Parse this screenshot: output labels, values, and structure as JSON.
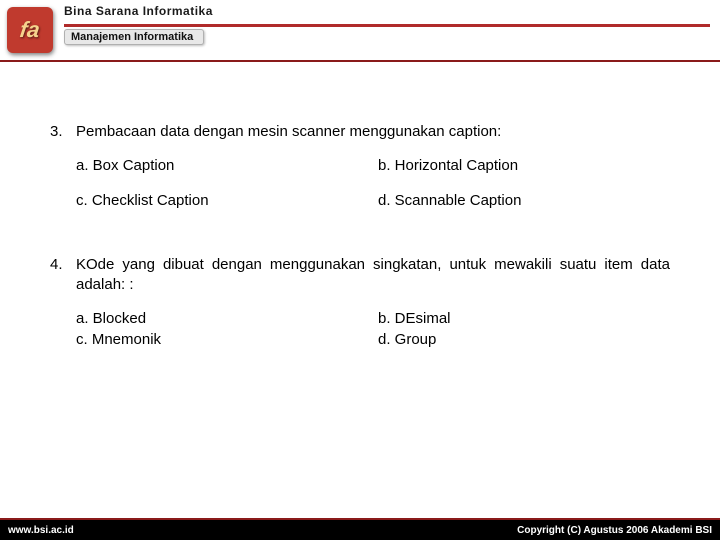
{
  "header": {
    "org_title": "Bina Sarana Informatika",
    "program": "Manajemen Informatika",
    "logo_text": "fa"
  },
  "questions": [
    {
      "num": "3.",
      "text": "Pembacaan data dengan mesin scanner menggunakan caption:",
      "opts": {
        "a": "a. Box Caption",
        "b": "b. Horizontal Caption",
        "c": "c. Checklist Caption",
        "d": "d. Scannable Caption"
      }
    },
    {
      "num": "4.",
      "text": "KOde yang dibuat dengan menggunakan singkatan, untuk mewakili suatu item data adalah: :",
      "opts": {
        "a": "a. Blocked",
        "b": "b. DEsimal",
        "c": "c. Mnemonik",
        "d": "d. Group"
      }
    }
  ],
  "footer": {
    "site": "www.bsi.ac.id",
    "copyright": "Copyright (C) Agustus 2006 Akademi BSI"
  }
}
